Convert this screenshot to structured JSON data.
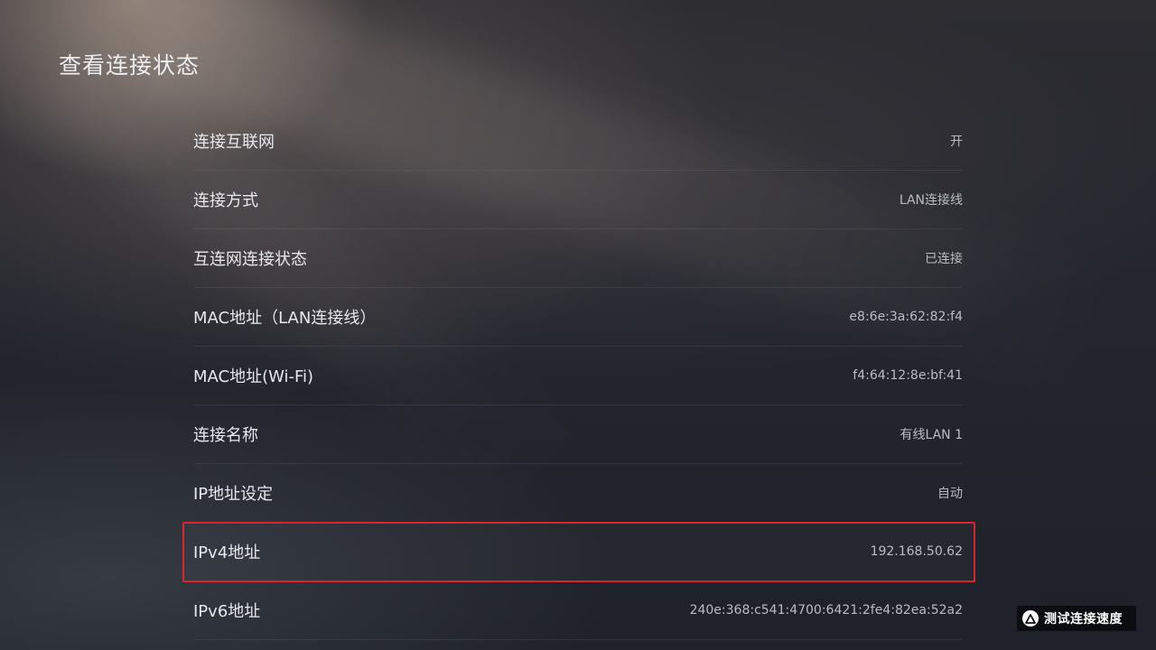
{
  "page": {
    "title": "查看连接状态"
  },
  "rows": [
    {
      "label": "连接互联网",
      "value": "开"
    },
    {
      "label": "连接方式",
      "value": "LAN连接线"
    },
    {
      "label": "互连网连接状态",
      "value": "已连接"
    },
    {
      "label": "MAC地址（LAN连接线）",
      "value": "e8:6e:3a:62:82:f4"
    },
    {
      "label": "MAC地址(Wi-Fi)",
      "value": "f4:64:12:8e:bf:41"
    },
    {
      "label": "连接名称",
      "value": "有线LAN 1"
    },
    {
      "label": "IP地址设定",
      "value": "自动"
    },
    {
      "label": "IPv4地址",
      "value": "192.168.50.62"
    },
    {
      "label": "IPv6地址",
      "value": "240e:368:c541:4700:6421:2fe4:82ea:52a2"
    }
  ],
  "selected_row": "IPv4地址",
  "actions": {
    "speed_test_label": "测试连接速度",
    "speed_test_icon": "triangle-button-icon"
  },
  "colors": {
    "selection_outline": "#d9262c"
  }
}
